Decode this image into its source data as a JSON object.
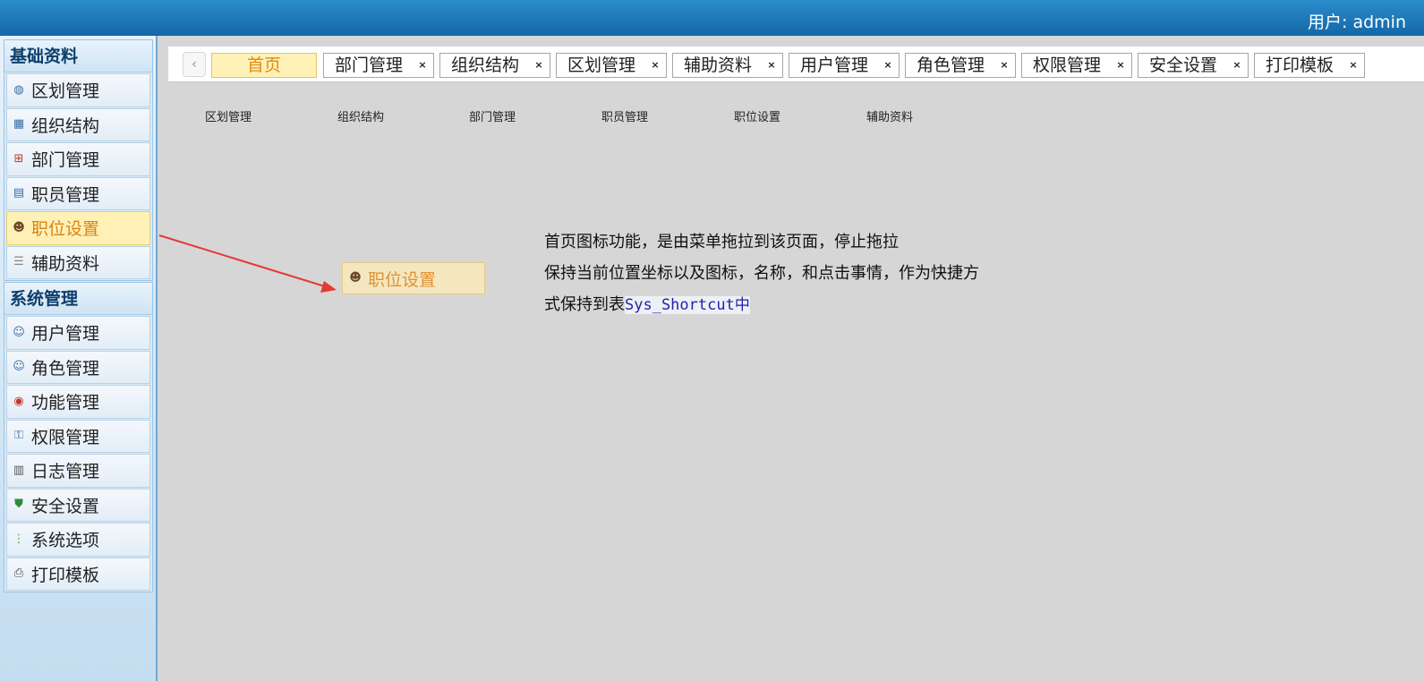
{
  "header": {
    "user_label": "用户: admin"
  },
  "sidebar": {
    "groups": [
      {
        "title": "基础资料",
        "items": [
          {
            "label": "区划管理",
            "icon": "globe-icon"
          },
          {
            "label": "组织结构",
            "icon": "org-icon"
          },
          {
            "label": "部门管理",
            "icon": "hierarchy-icon"
          },
          {
            "label": "职员管理",
            "icon": "id-card-icon"
          },
          {
            "label": "职位设置",
            "icon": "person-icon",
            "active": true
          },
          {
            "label": "辅助资料",
            "icon": "list-icon"
          }
        ]
      },
      {
        "title": "系统管理",
        "items": [
          {
            "label": "用户管理",
            "icon": "user-icon"
          },
          {
            "label": "角色管理",
            "icon": "users-icon"
          },
          {
            "label": "功能管理",
            "icon": "module-icon"
          },
          {
            "label": "权限管理",
            "icon": "key-icon"
          },
          {
            "label": "日志管理",
            "icon": "log-icon"
          },
          {
            "label": "安全设置",
            "icon": "shield-icon"
          },
          {
            "label": "系统选项",
            "icon": "options-icon"
          },
          {
            "label": "打印模板",
            "icon": "printer-icon"
          }
        ]
      }
    ]
  },
  "tabs": {
    "prev_label": "‹",
    "items": [
      {
        "label": "首页",
        "closable": false,
        "active": true
      },
      {
        "label": "部门管理",
        "closable": true
      },
      {
        "label": "组织结构",
        "closable": true
      },
      {
        "label": "区划管理",
        "closable": true
      },
      {
        "label": "辅助资料",
        "closable": true
      },
      {
        "label": "用户管理",
        "closable": true
      },
      {
        "label": "角色管理",
        "closable": true
      },
      {
        "label": "权限管理",
        "closable": true
      },
      {
        "label": "安全设置",
        "closable": true
      },
      {
        "label": "打印模板",
        "closable": true
      }
    ],
    "close_glyph": "×"
  },
  "content": {
    "shortcuts": [
      "区划管理",
      "组织结构",
      "部门管理",
      "职员管理",
      "职位设置",
      "辅助资料"
    ],
    "dragged_item": {
      "label": "职位设置",
      "icon": "person-icon"
    },
    "note": {
      "line1": "首页图标功能，是由菜单拖拉到该页面，停止拖拉",
      "line2": "保持当前位置坐标以及图标，名称，和点击事情，作为快捷方",
      "line3_prefix": "式保持到表",
      "line3_code": "Sys_Shortcut中"
    },
    "arrow_color": "#e53935"
  }
}
